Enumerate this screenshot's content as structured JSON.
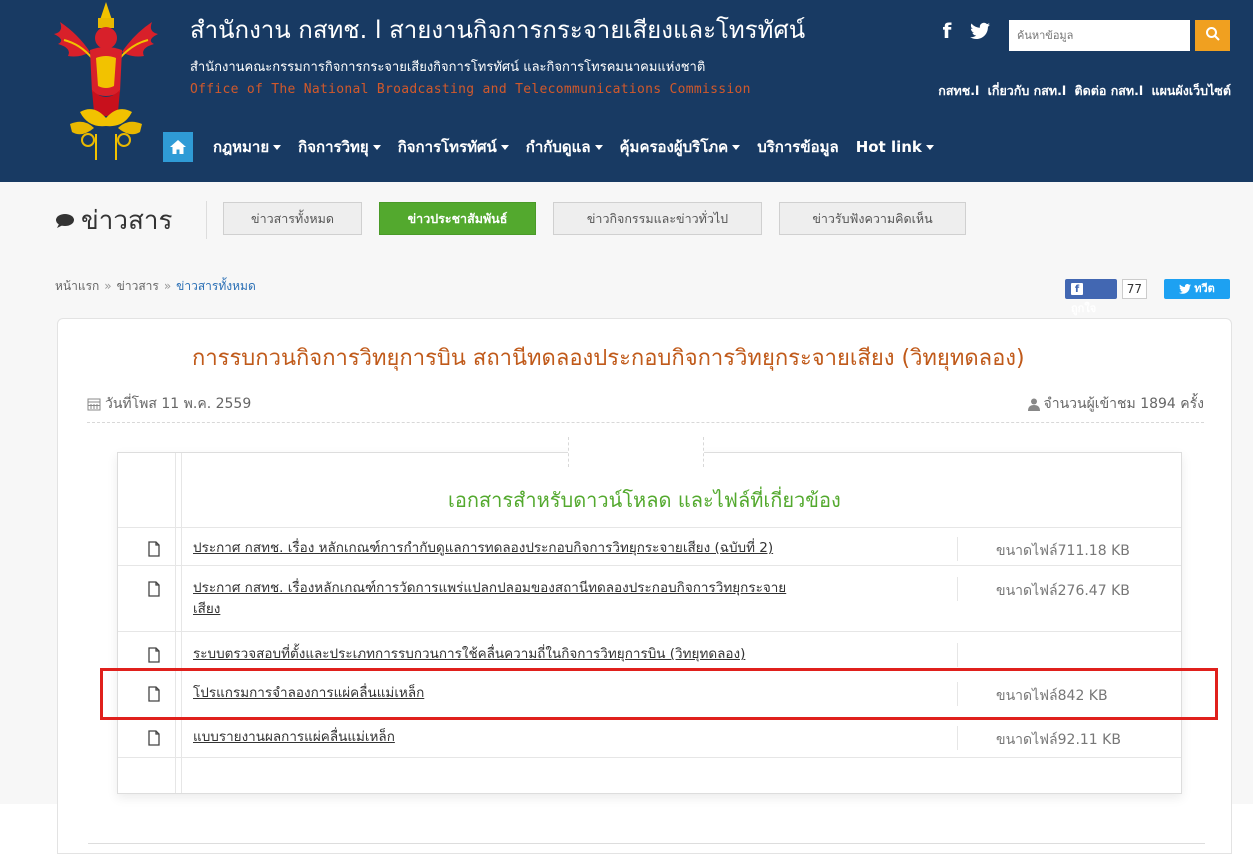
{
  "header": {
    "title": "สำนักงาน กสทช. l สายงานกิจการกระจายเสียงและโทรทัศน์",
    "subtitle_th": "สำนักงานคณะกรรมการกิจการกระจายเสียงกิจการโทรทัศน์ และกิจการโทรคมนาคมแห่งชาติ",
    "subtitle_en": "Office of The National Broadcasting and Telecommunications Commission",
    "search_placeholder": "ค้นหาข้อมูล",
    "top_links": [
      "กสทช.l",
      "เกี่ยวกับ กสท.l",
      "ติดต่อ กสท.l",
      "แผนผังเว็บไซต์"
    ],
    "nav": [
      "กฎหมาย",
      "กิจการวิทยุ",
      "กิจการโทรทัศน์",
      "กำกับดูแล",
      "คุ้มครองผู้บริโภค",
      "บริการข้อมูล",
      "Hot link"
    ],
    "nav_has_caret": [
      true,
      true,
      true,
      true,
      true,
      false,
      true
    ],
    "colors": {
      "header_bg": "#183a63",
      "accent_orange": "#f0a020",
      "home_blue": "#2f9bd6"
    }
  },
  "section": {
    "heading": "ข่าวสาร",
    "tabs": [
      {
        "label": "ข่าวสารทั้งหมด",
        "active": false
      },
      {
        "label": "ข่าวประชาสัมพันธ์",
        "active": true
      },
      {
        "label": "ข่าวกิจกรรมและข่าวทั่วไป",
        "active": false
      },
      {
        "label": "ข่าวรับฟังความคิดเห็น",
        "active": false
      }
    ]
  },
  "breadcrumb": {
    "items": [
      "หน้าแรก",
      "ข่าวสาร",
      "ข่าวสารทั้งหมด"
    ],
    "separator": "»"
  },
  "social": {
    "like_label": "ถูกใจ",
    "like_count": "77",
    "tweet_label": "ทวีต"
  },
  "article": {
    "title": "การรบกวนกิจการวิทยุการบิน สถานีทดลองประกอบกิจการวิทยุกระจายเสียง (วิทยุทดลอง)",
    "post_date": "วันที่โพส 11 พ.ค. 2559",
    "views": "จำนวนผู้เข้าชม 1894 ครั้ง"
  },
  "downloads": {
    "heading": "เอกสารสำหรับดาวน์โหลด และไฟล์ที่เกี่ยวข้อง",
    "files": [
      {
        "name": "ประกาศ กสทช. เรื่อง หลักเกณฑ์การกำกับดูแลการทดลองประกอบกิจการวิทยุกระจายเสียง (ฉบับที่ 2)",
        "size": "ขนาดไฟล์711.18 KB"
      },
      {
        "name": "ประกาศ กสทช. เรื่องหลักเกณฑ์การวัดการแพร่แปลกปลอมของสถานีทดลองประกอบกิจการวิทยุกระจาย",
        "name_line2": "เสียง",
        "size": "ขนาดไฟล์276.47 KB"
      },
      {
        "name": "ระบบตรวจสอบที่ตั้งและประเภทการรบกวนการใช้คลื่นความถี่ในกิจการวิทยุการบิน (วิทยุทดลอง)",
        "size": ""
      },
      {
        "name": "โปรแกรมการจำลองการแผ่คลื่นแม่เหล็ก",
        "size": "ขนาดไฟล์842 KB",
        "highlighted": true
      },
      {
        "name": "แบบรายงานผลการแผ่คลื่นแม่เหล็ก",
        "size": "ขนาดไฟล์92.11 KB"
      }
    ]
  }
}
